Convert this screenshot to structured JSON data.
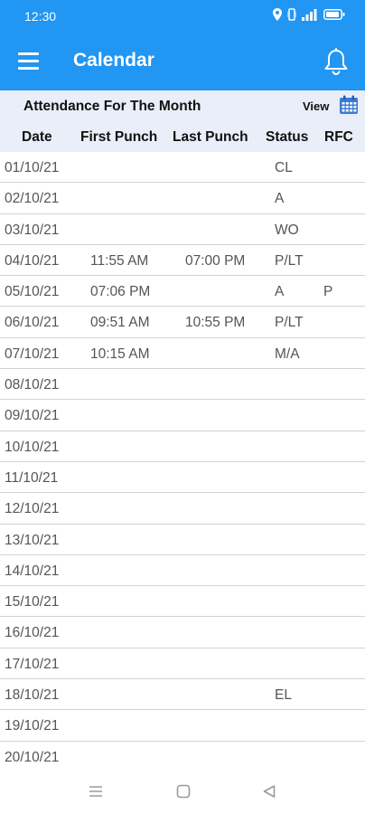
{
  "status_bar": {
    "time": "12:30"
  },
  "app_bar": {
    "title": "Calendar"
  },
  "sub_header": {
    "heading": "Attendance For The Month",
    "view_label": "View"
  },
  "columns": [
    "Date",
    "First Punch",
    "Last Punch",
    "Status",
    "RFC"
  ],
  "rows": [
    {
      "date": "01/10/21",
      "first": "",
      "last": "",
      "status": "CL",
      "rfc": ""
    },
    {
      "date": "02/10/21",
      "first": "",
      "last": "",
      "status": "A",
      "rfc": ""
    },
    {
      "date": "03/10/21",
      "first": "",
      "last": "",
      "status": "WO",
      "rfc": ""
    },
    {
      "date": "04/10/21",
      "first": "11:55 AM",
      "last": "07:00 PM",
      "status": "P/LT",
      "rfc": ""
    },
    {
      "date": "05/10/21",
      "first": "07:06 PM",
      "last": "",
      "status": "A",
      "rfc": "P"
    },
    {
      "date": "06/10/21",
      "first": "09:51 AM",
      "last": "10:55 PM",
      "status": "P/LT",
      "rfc": ""
    },
    {
      "date": "07/10/21",
      "first": "10:15 AM",
      "last": "",
      "status": "M/A",
      "rfc": ""
    },
    {
      "date": "08/10/21",
      "first": "",
      "last": "",
      "status": "",
      "rfc": ""
    },
    {
      "date": "09/10/21",
      "first": "",
      "last": "",
      "status": "",
      "rfc": ""
    },
    {
      "date": "10/10/21",
      "first": "",
      "last": "",
      "status": "",
      "rfc": ""
    },
    {
      "date": "11/10/21",
      "first": "",
      "last": "",
      "status": "",
      "rfc": ""
    },
    {
      "date": "12/10/21",
      "first": "",
      "last": "",
      "status": "",
      "rfc": ""
    },
    {
      "date": "13/10/21",
      "first": "",
      "last": "",
      "status": "",
      "rfc": ""
    },
    {
      "date": "14/10/21",
      "first": "",
      "last": "",
      "status": "",
      "rfc": ""
    },
    {
      "date": "15/10/21",
      "first": "",
      "last": "",
      "status": "",
      "rfc": ""
    },
    {
      "date": "16/10/21",
      "first": "",
      "last": "",
      "status": "",
      "rfc": ""
    },
    {
      "date": "17/10/21",
      "first": "",
      "last": "",
      "status": "",
      "rfc": ""
    },
    {
      "date": "18/10/21",
      "first": "",
      "last": "",
      "status": "EL",
      "rfc": ""
    },
    {
      "date": "19/10/21",
      "first": "",
      "last": "",
      "status": "",
      "rfc": ""
    },
    {
      "date": "20/10/21",
      "first": "",
      "last": "",
      "status": "",
      "rfc": ""
    }
  ],
  "icons": {
    "status_bar": [
      "location-icon",
      "vibrate-icon",
      "signal-icon",
      "battery-icon"
    ],
    "app_bar": [
      "hamburger-menu-icon",
      "bell-icon"
    ],
    "sub_header": [
      "calendar-icon"
    ],
    "nav_bar": [
      "recents-icon",
      "home-icon",
      "back-icon"
    ]
  },
  "colors": {
    "primary": "#2196f3",
    "header_bg": "#e9eef8",
    "calendar_icon": "#3b7bd6"
  }
}
